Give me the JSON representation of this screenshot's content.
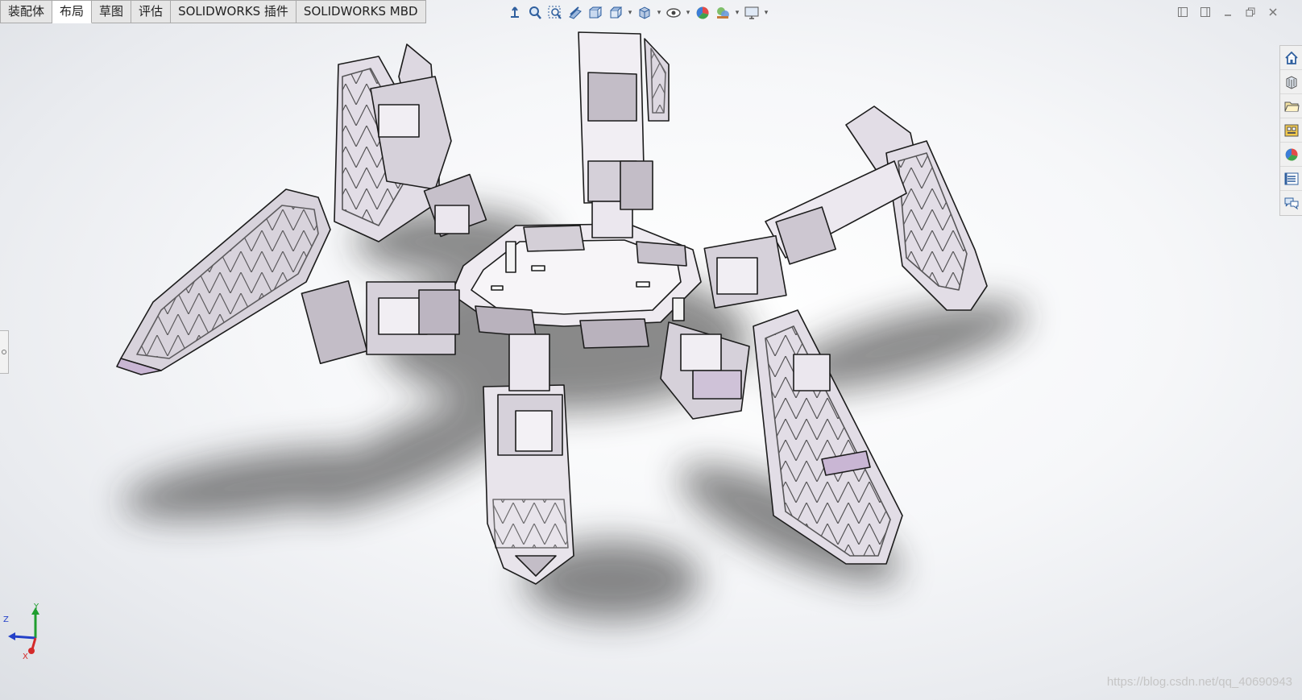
{
  "tabs": [
    {
      "label": "装配体",
      "active": false
    },
    {
      "label": "布局",
      "active": true
    },
    {
      "label": "草图",
      "active": false
    },
    {
      "label": "评估",
      "active": false
    },
    {
      "label": "SOLIDWORKS 插件",
      "active": false
    },
    {
      "label": "SOLIDWORKS MBD",
      "active": false
    }
  ],
  "heads_up_toolbar": {
    "icons": [
      "zoom-to-fit-icon",
      "zoom-to-area-icon",
      "previous-view-icon",
      "section-view-icon",
      "dynamic-annotation-icon",
      "view-orientation-icon",
      "display-style-icon",
      "hide-show-items-icon",
      "edit-appearance-icon",
      "apply-scene-icon",
      "view-settings-icon"
    ]
  },
  "task_pane": {
    "icons": [
      "home-icon",
      "design-library-icon",
      "file-explorer-icon",
      "view-palette-icon",
      "appearances-icon",
      "custom-properties-icon",
      "forum-icon"
    ]
  },
  "triad": {
    "x": "X",
    "y": "Y",
    "z": "Z"
  },
  "watermark": "https://blog.csdn.net/qq_40690943",
  "colors": {
    "part_fill": "#e7e2ea",
    "part_shade": "#b9b2bd",
    "part_edge": "#1c1c1c",
    "shadow": "#2a2a2a",
    "tab_active": "#ffffff",
    "tab_inactive": "#e6e6e6"
  }
}
